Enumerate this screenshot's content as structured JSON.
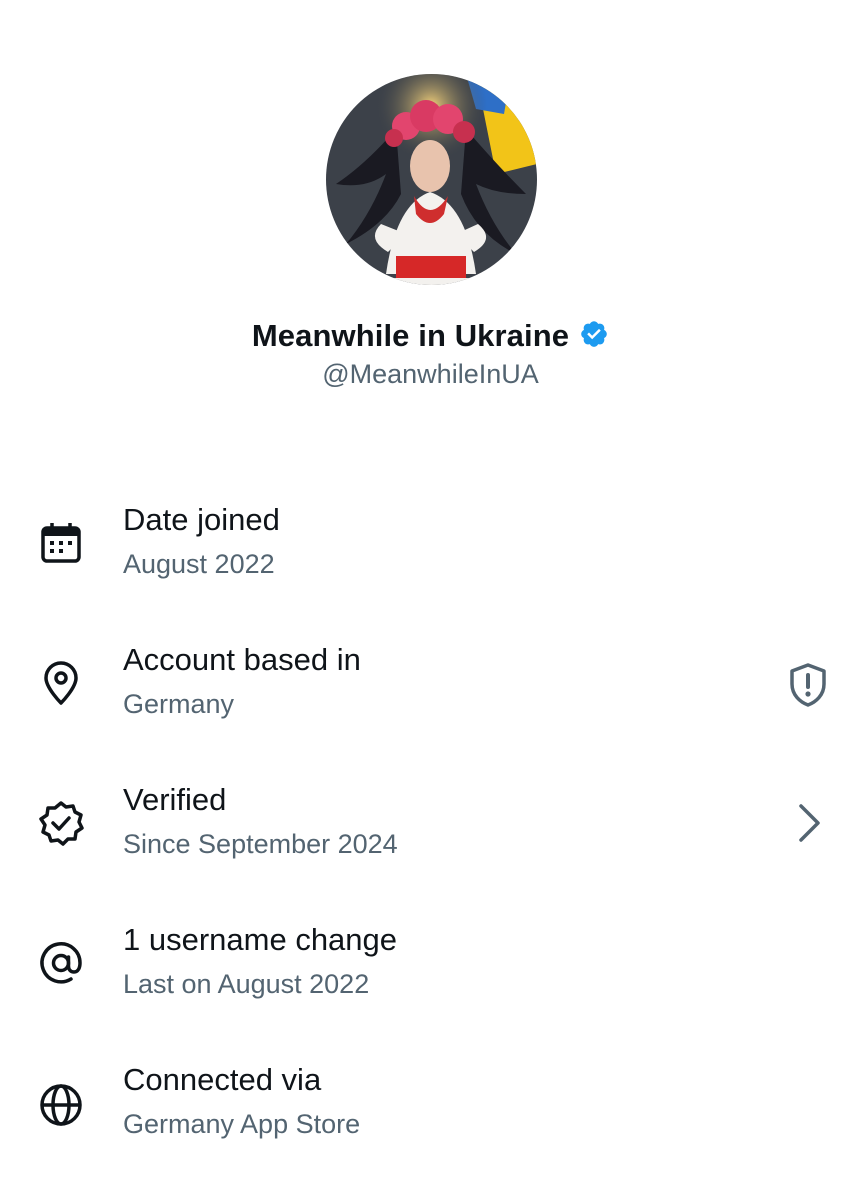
{
  "profile": {
    "display_name": "Meanwhile in Ukraine",
    "handle": "@MeanwhileInUA",
    "verified_color": "#1d9bf0"
  },
  "rows": [
    {
      "icon": "calendar-icon",
      "title": "Date joined",
      "subtitle": "August 2022"
    },
    {
      "icon": "location-pin-icon",
      "title": "Account based in",
      "subtitle": "Germany",
      "right_icon": "shield-alert-icon"
    },
    {
      "icon": "verified-badge-icon",
      "title": "Verified",
      "subtitle": "Since September 2024",
      "right_icon": "chevron-right-icon"
    },
    {
      "icon": "at-sign-icon",
      "title": "1 username change",
      "subtitle": "Last on August 2022"
    },
    {
      "icon": "globe-icon",
      "title": "Connected via",
      "subtitle": "Germany App Store"
    }
  ],
  "colors": {
    "primary_text": "#0f1419",
    "secondary_text": "#536471",
    "accent": "#1d9bf0"
  }
}
